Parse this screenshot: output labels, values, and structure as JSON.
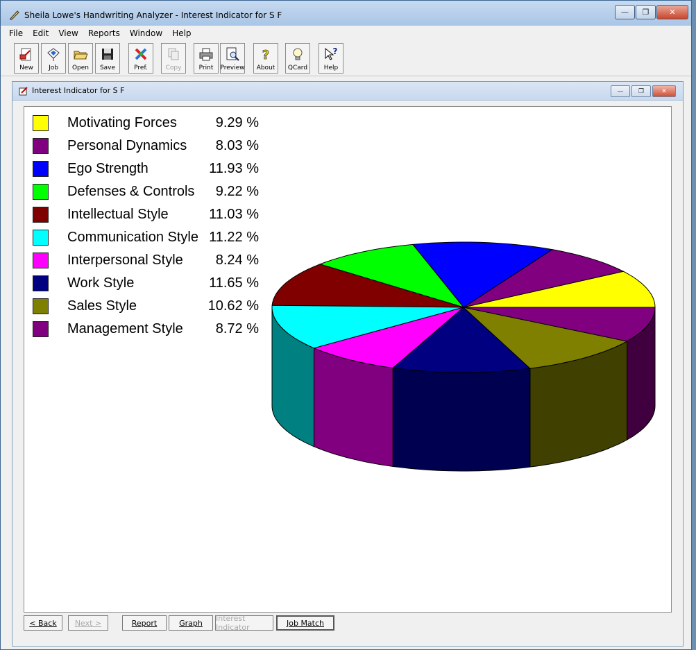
{
  "window": {
    "title": "Sheila Lowe's Handwriting Analyzer - Interest Indicator for S F",
    "minimize": "—",
    "restore": "❐",
    "close": "✕"
  },
  "menu": [
    "File",
    "Edit",
    "View",
    "Reports",
    "Window",
    "Help"
  ],
  "toolbar": [
    {
      "label": "New",
      "icon": "new-icon",
      "enabled": true
    },
    {
      "label": "Job",
      "icon": "job-icon",
      "enabled": true
    },
    {
      "label": "Open",
      "icon": "open-folder-icon",
      "enabled": true
    },
    {
      "label": "Save",
      "icon": "save-disk-icon",
      "enabled": true
    },
    {
      "label": "Pref.",
      "icon": "preferences-icon",
      "enabled": true
    },
    {
      "label": "Copy",
      "icon": "copy-icon",
      "enabled": false
    },
    {
      "label": "Print",
      "icon": "printer-icon",
      "enabled": true
    },
    {
      "label": "Preview",
      "icon": "preview-icon",
      "enabled": true
    },
    {
      "label": "About",
      "icon": "about-question-icon",
      "enabled": true
    },
    {
      "label": "QCard",
      "icon": "lightbulb-icon",
      "enabled": true
    },
    {
      "label": "Help",
      "icon": "help-pointer-icon",
      "enabled": true
    }
  ],
  "doc_window": {
    "title": "Interest Indicator for S F"
  },
  "chart_data": {
    "type": "pie",
    "title": "",
    "style": "3d",
    "categories": [
      "Motivating Forces",
      "Personal Dynamics",
      "Ego Strength",
      "Defenses & Controls",
      "Intellectual Style",
      "Communication Style",
      "Interpersonal Style",
      "Work Style",
      "Sales Style",
      "Management Style"
    ],
    "values": [
      9.29,
      8.03,
      11.93,
      9.22,
      11.03,
      11.22,
      8.24,
      11.65,
      10.62,
      8.72
    ],
    "value_labels": [
      "9.29 %",
      "8.03 %",
      "11.93 %",
      "9.22 %",
      "11.03 %",
      "11.22 %",
      "8.24 %",
      "11.65 %",
      "10.62 %",
      "8.72 %"
    ],
    "colors": [
      "#ffff00",
      "#800080",
      "#0000ff",
      "#00ff00",
      "#800000",
      "#00ffff",
      "#ff00ff",
      "#000080",
      "#808000",
      "#800080"
    ],
    "side_colors": [
      "#7f7f00",
      "#400040",
      "#00007f",
      "#007f00",
      "#400000",
      "#008080",
      "#800080",
      "#000050",
      "#404000",
      "#400040"
    ],
    "legend_placement": "left"
  },
  "nav": [
    {
      "label": "< Back",
      "enabled": true
    },
    {
      "label": "Next >",
      "enabled": false
    },
    {
      "label": "Report",
      "enabled": true
    },
    {
      "label": "Graph",
      "enabled": true
    },
    {
      "label": "Interest Indicator",
      "enabled": false
    },
    {
      "label": "Job Match",
      "enabled": true
    }
  ]
}
